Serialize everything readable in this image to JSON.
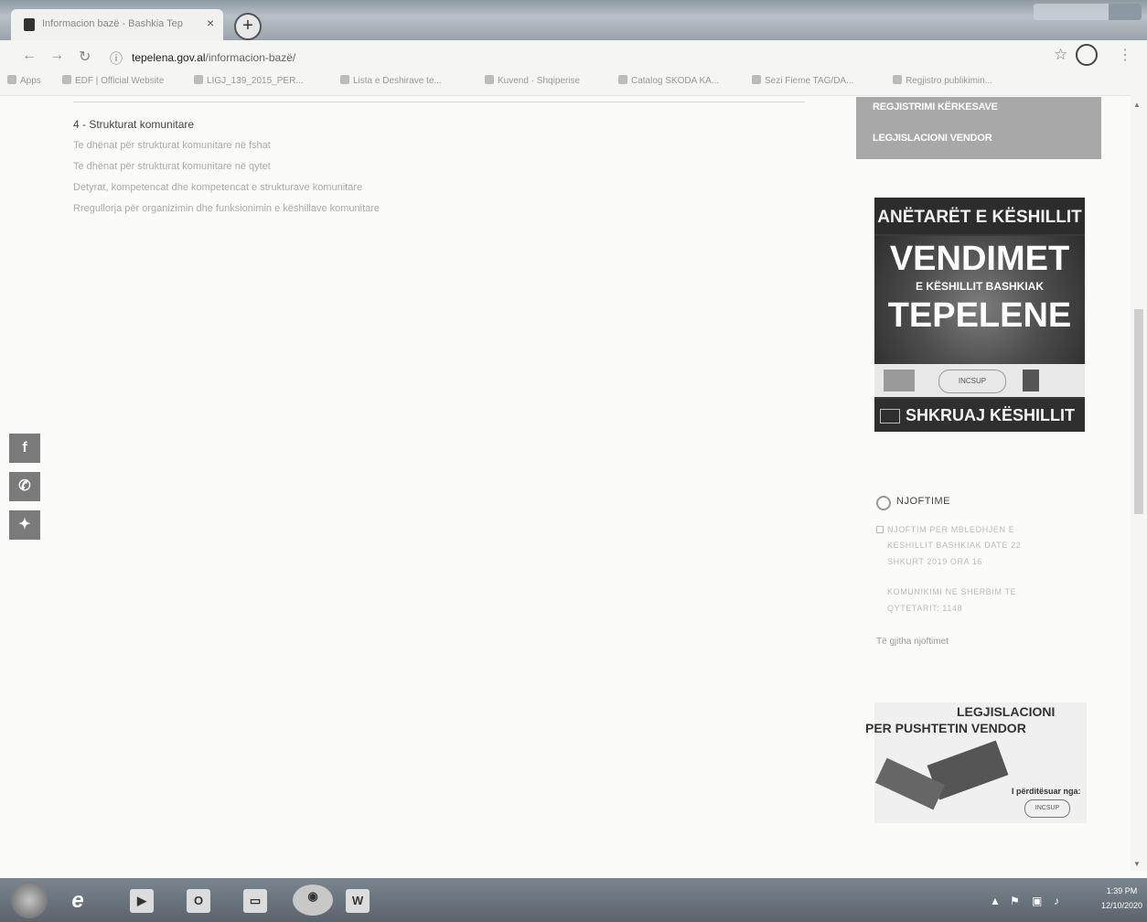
{
  "browser": {
    "tab_title": "Informacion bazë - Bashkia Tep",
    "new_tab": "+",
    "close_tab": "×",
    "url_domain": "tepelena.gov.al",
    "url_path": "/informacion-bazë/",
    "bookmarks": [
      "Apps",
      "EDF | Official Website",
      "LIGJ_139_2015_PER...",
      "Lista e Deshirave te...",
      "Kuvend · Shqiperise",
      "Catalog SKODA KA...",
      "Sezi Fieme TAG/DA...",
      "Regjistro publikimin..."
    ]
  },
  "content": {
    "heading": "4 - Strukturat komunitare",
    "links": [
      "Te dhënat për strukturat komunitare në fshat",
      "Te dhënat për strukturat komunitare në qytet",
      "Detyrat, kompetencat dhe kompetencat e strukturave komunitare",
      "Rregullorja për organizimin dhe funksionimin e këshillave komunitare"
    ]
  },
  "sidebar": {
    "menu": [
      "REGJISTRIMI KËRKESAVE",
      "LEGJISLACIONI VENDOR"
    ],
    "banner": {
      "header": "ANËTARËT E KËSHILLIT",
      "line1": "VENDIMET",
      "line2": "E KËSHILLIT BASHKIAK",
      "line3": "TEPELENE",
      "write": "SHKRUAJ KËSHILLIT",
      "logo_text": "INCSUP"
    },
    "notices": {
      "title": "NJOFTIME",
      "item1_lines": [
        "NJOFTIM PER MBLEDHJEN E",
        "KESHILLIT BASHKIAK DATE 22",
        "SHKURT 2019 ORA 16"
      ],
      "item2_lines": [
        "KOMUNIKIMI NE SHERBIM TE",
        "QYTETARIT: 1148"
      ],
      "all": "Të gjitha njoftimet"
    },
    "legislation": {
      "title1": "LEGJISLACIONI",
      "title2": "PER PUSHTETIN VENDOR",
      "note": "I përditësuar nga:",
      "seal": "INCSUP"
    }
  },
  "taskbar": {
    "time": "1:39 PM",
    "date": "12/10/2020"
  },
  "colors": {
    "page_bg": "#fbfbf9",
    "sidebar_menu": "#a8a8a8",
    "banner_dark": "#2f2f2f",
    "taskbar": "#6b747d"
  }
}
